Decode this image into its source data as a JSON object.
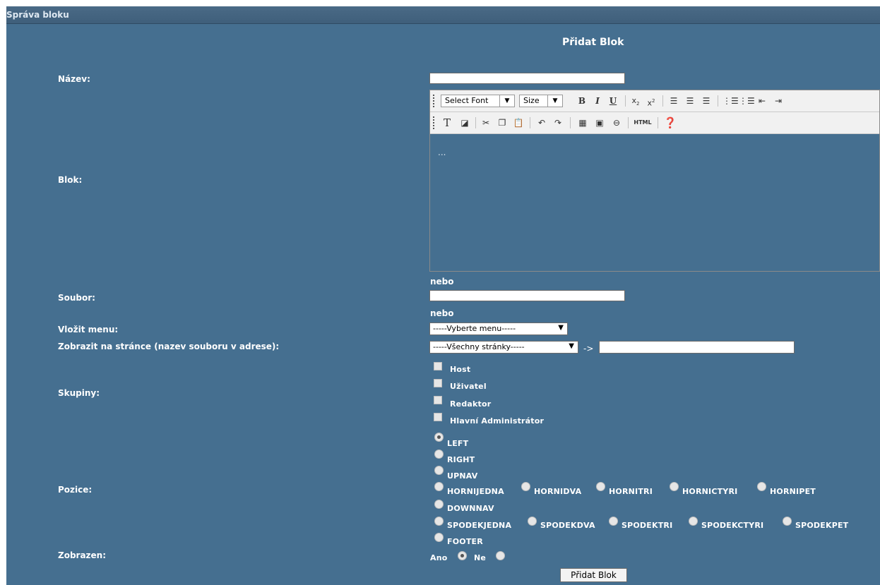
{
  "header": {
    "title": "Správa bloku"
  },
  "form": {
    "title": "Přidat Blok",
    "name_label": "Název:",
    "block_label": "Blok:",
    "or_text": "nebo",
    "file_label": "Soubor:",
    "menu_label": "Vložit menu:",
    "menu_select": "-----Vyberte menu-----",
    "page_label": "Zobrazit na stránce (nazev souboru v adrese):",
    "page_select": "-----Všechny stránky-----",
    "page_arrow": "->",
    "groups_label": "Skupiny:",
    "groups": [
      "Host",
      "Uživatel",
      "Redaktor",
      "Hlavní Administrátor"
    ],
    "position_label": "Pozice:",
    "positions": [
      "LEFT",
      "RIGHT",
      "UPNAV",
      "HORNIJEDNA",
      "HORNIDVA",
      "HORNITRI",
      "HORNICTYRI",
      "HORNIPET",
      "DOWNNAV",
      "SPODEKJEDNA",
      "SPODEKDVA",
      "SPODEKTRI",
      "SPODEKCTYRI",
      "SPODEKPET",
      "FOOTER"
    ],
    "position_selected": "LEFT",
    "visible_label": "Zobrazen:",
    "visible_yes": "Ano",
    "visible_no": "Ne",
    "visible_selected": "Ano",
    "submit": "Přidat Blok"
  },
  "editor": {
    "font_select": "Select Font",
    "size_select": "Size",
    "bold_icon": "B",
    "italic_icon": "I",
    "underline_icon": "U",
    "html_button": "HTML",
    "content": "..."
  },
  "colors": {
    "panel": "#456f90",
    "header": "#456680"
  }
}
